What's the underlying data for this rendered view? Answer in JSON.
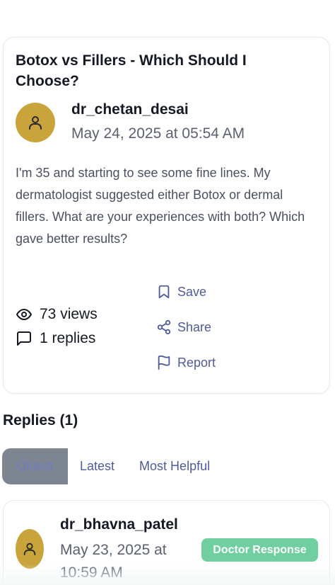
{
  "post": {
    "title": "Botox vs Fillers - Which Should I Choose?",
    "author": "dr_chetan_desai",
    "date": "May 24, 2025 at 05:54 AM",
    "body": "I'm 35 and starting to see some fine lines. My dermatologist suggested either Botox or dermal fillers. What are your experiences with both? Which gave better results?",
    "views": "73 views",
    "replies": "1 replies",
    "actions": {
      "save": "Save",
      "share": "Share",
      "report": "Report"
    }
  },
  "replies_section": {
    "heading": "Replies (1)",
    "tabs": [
      "Oldest",
      "Latest",
      "Most Helpful"
    ],
    "selected_tab": "Oldest"
  },
  "reply": {
    "author": "dr_bhavna_patel",
    "date": "May 23, 2025 at 10:59 AM",
    "badge": "Doctor Response"
  },
  "colors": {
    "avatar": "#c9a43a",
    "accent": "#4f5b9a",
    "badge": "#6fcf9f",
    "selected_tab": "#7d8591"
  },
  "icons": [
    "user-icon",
    "eye-icon",
    "chat-bubble-icon",
    "bookmark-icon",
    "share-icon",
    "flag-icon"
  ]
}
